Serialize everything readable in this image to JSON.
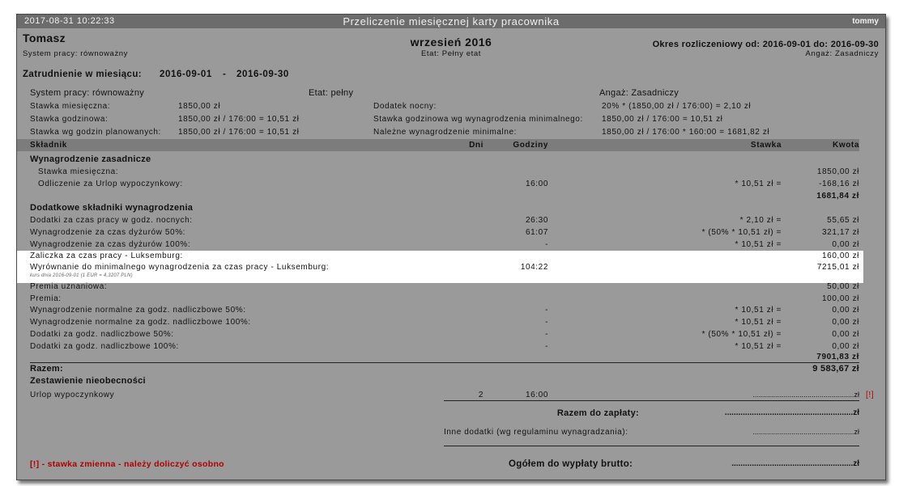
{
  "window": {
    "timestamp": "2017-08-31  10:22:33",
    "title": "Przeliczenie miesięcznej karty pracownika",
    "user": "tommy"
  },
  "header": {
    "employee_name": "Tomasz",
    "system_pracy": "System pracy: równoważny",
    "month": "wrzesień 2016",
    "etat": "Etat: Pełny etat",
    "okres": "Okres rozliczeniowy od: 2016-09-01 do: 2016-09-30",
    "angaz": "Angaż: Zasadniczy",
    "zatrudnienie_label": "Zatrudnienie w miesiącu:",
    "zatrudnienie_from": "2016-09-01",
    "zatrudnienie_sep": "-",
    "zatrudnienie_to": "2016-09-30"
  },
  "info": {
    "system": "System pracy: równoważny",
    "etat": "Etat: pełny",
    "angaz": "Angaż: Zasadniczy",
    "rows": [
      {
        "l1": "Stawka miesięczna:",
        "v1": "1850,00 zł",
        "l2": "Dodatek nocny:",
        "v2": "20% * (1850,00 zł / 176:00) = 2,10 zł"
      },
      {
        "l1": "Stawka godzinowa:",
        "v1": "1850,00 zł / 176:00 = 10,51 zł",
        "l2": "Stawka godzinowa wg wynagrodzenia minimalnego:",
        "v2": "1850,00 zł / 176:00 = 10,51 zł"
      },
      {
        "l1": "Stawka wg godzin planowanych:",
        "v1": "1850,00 zł / 176:00 = 10,51 zł",
        "l2": "Należne wynagrodzenie minimalne:",
        "v2": "1850,00 zł / 176:00 * 160:00 = 1681,82 zł"
      }
    ]
  },
  "table": {
    "headers": {
      "skladnik": "Składnik",
      "dni": "Dni",
      "godziny": "Godziny",
      "stawka": "Stawka",
      "kwota": "Kwota"
    },
    "section1_title": "Wynagrodzenie zasadnicze",
    "section1_rows": [
      {
        "name": "Stawka miesięczna:",
        "godziny": "",
        "stawka": "",
        "kwota": "1850,00 zł"
      },
      {
        "name": "Odliczenie za Urlop wypoczynkowy:",
        "godziny": "16:00",
        "stawka": "* 10,51 zł =",
        "kwota": "-168,16 zł"
      }
    ],
    "section1_total": "1681,84 zł",
    "section2_title": "Dodatkowe składniki wynagrodzenia",
    "section2_rows": [
      {
        "name": "Dodatki za czas pracy w godz. nocnych:",
        "godziny": "26:30",
        "stawka": "* 2,10 zł =",
        "kwota": "55,65 zł"
      },
      {
        "name": "Wynagrodzenie za czas dyżurów 50%:",
        "godziny": "61:07",
        "stawka": "* (50% * 10,51 zł) =",
        "kwota": "321,17 zł"
      },
      {
        "name": "Wynagrodzenie za czas dyżurów 100%:",
        "godziny": "-",
        "stawka": "* 10,51 zł =",
        "kwota": "0,00 zł"
      }
    ],
    "highlight_rows": [
      {
        "name": "Zaliczka za czas pracy - Luksemburg:",
        "godziny": "",
        "kwota": "160,00 zł"
      },
      {
        "name": "Wyrównanie do minimalnego wynagrodzenia za czas pracy - Luksemburg:",
        "godziny": "104:22",
        "kwota": "7215,01 zł"
      }
    ],
    "kurs_note": "kurs dnia 2016-09-01 (1 EUR = 4,3207 PLN)",
    "section3_rows": [
      {
        "name": "Premia uznaniowa:",
        "godziny": "",
        "stawka": "",
        "kwota": "50,00 zł"
      },
      {
        "name": "Premia:",
        "godziny": "",
        "stawka": "",
        "kwota": "100,00 zł"
      },
      {
        "name": "Wynagrodzenie normalne za godz. nadliczbowe 50%:",
        "godziny": "-",
        "stawka": "* 10,51 zł =",
        "kwota": "0,00 zł"
      },
      {
        "name": "Wynagrodzenie normalne za godz. nadliczbowe 100%:",
        "godziny": "-",
        "stawka": "* 10,51 zł =",
        "kwota": "0,00 zł"
      },
      {
        "name": "Dodatki za godz. nadliczbowe 50%:",
        "godziny": "-",
        "stawka": "* (50% * 10,51 zł) =",
        "kwota": "0,00 zł"
      },
      {
        "name": "Dodatki za godz. nadliczbowe 100%:",
        "godziny": "-",
        "stawka": "* 10,51 zł =",
        "kwota": "0,00 zł"
      }
    ],
    "section2_total": "7901,83 zł",
    "razem_label": "Razem:",
    "razem_value": "9 583,67 zł"
  },
  "absence": {
    "title": "Zestawienie nieobecności",
    "name": "Urlop wypoczynkowy",
    "dni": "2",
    "godziny": "16:00",
    "dots": "..................................................zł",
    "flag": "[!]"
  },
  "summary": {
    "razem_do_zaplaty_label": "Razem do zapłaty:",
    "razem_do_zaplaty_dots": ".........................................................zł",
    "inne_label": "Inne dodatki (wg regulaminu wynagradzania):",
    "inne_dots": "..................................................zł",
    "ogolem_label": "Ogółem do wypłaty brutto:",
    "ogolem_dots": "......................................................zł",
    "footnote": "[!] - stawka zmienna - należy doliczyć osobno"
  }
}
